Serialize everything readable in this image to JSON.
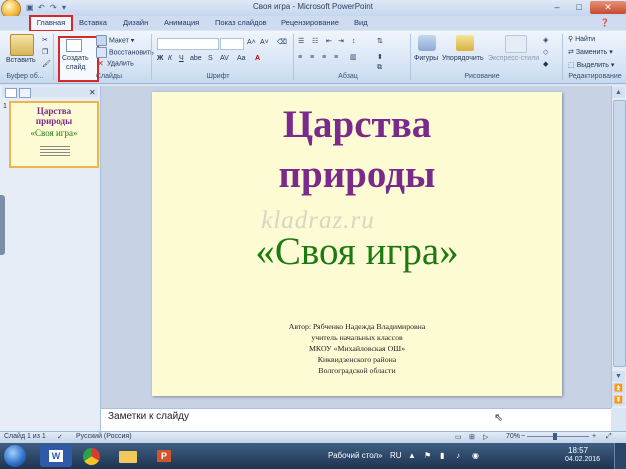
{
  "window": {
    "title": "Своя игра - Microsoft PowerPoint",
    "controls": [
      "–",
      "□",
      "✕"
    ]
  },
  "tabs": [
    "Главная",
    "Вставка",
    "Дизайн",
    "Анимация",
    "Показ слайдов",
    "Рецензирование",
    "Вид"
  ],
  "ribbon": {
    "clipboard": {
      "paste": "Вставить",
      "label": "Буфер об..."
    },
    "slides": {
      "new_slide_1": "Создать",
      "new_slide_2": "слайд",
      "layout": "Макет",
      "reset": "Восстановить",
      "delete": "Удалить",
      "label": "Слайды"
    },
    "font": {
      "label": "Шрифт"
    },
    "paragraph": {
      "label": "Абзац"
    },
    "drawing": {
      "shapes": "Фигуры",
      "arrange": "Упорядочить",
      "quick_styles": "Экспресс-стили",
      "label": "Рисование"
    },
    "editing": {
      "find": "Найти",
      "replace": "Заменить",
      "select": "Выделить",
      "label": "Редактирование"
    }
  },
  "thumbnail": {
    "number": "1",
    "line1": "Царства",
    "line2": "природы",
    "line3": "«Своя игра»"
  },
  "slide": {
    "title_line1": "Царства",
    "title_line2": "природы",
    "subtitle": "«Своя игра»",
    "watermark": "kladraz.ru",
    "author_lines": [
      "Автор: Рябченко Надежда Владимировна",
      "учитель начальных классов",
      "МКОУ «Михайловская ОШ»",
      "Киквидзенского района",
      "Волгоградской области"
    ]
  },
  "notes": {
    "placeholder": "Заметки к слайду"
  },
  "status": {
    "slide_info": "Слайд 1 из 1",
    "language": "Русский (Россия)",
    "zoom": "70%"
  },
  "taskbar": {
    "desktop": "Рабочий стол",
    "lang": "RU",
    "time": "18:57",
    "date": "04.02.2016"
  },
  "colors": {
    "title_purple": "#7a2a8a",
    "subtitle_green": "#1e7a10",
    "slide_bg": "#fdfbd3",
    "highlight_red": "#d62828"
  }
}
